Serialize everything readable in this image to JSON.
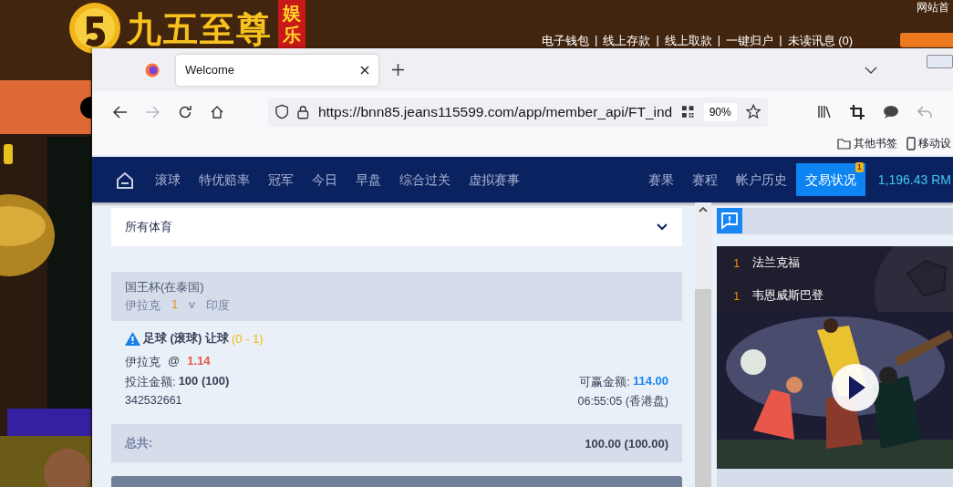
{
  "site_header": {
    "logo_text": "九五至尊",
    "logo_badge": "娱乐",
    "top_link": "网站首",
    "separator": "|",
    "links": [
      "电子钱包",
      "线上存款",
      "线上取款",
      "一键归户",
      "未读讯息 (0)"
    ]
  },
  "browser": {
    "tabs": [
      {
        "label": "Welcome",
        "selected": true
      }
    ],
    "url": "https://bnn85.jeans115599.com/app/member_api/FT_ind",
    "zoom": "90%",
    "forward_disabled": true,
    "bookmarks": [
      "其他书签",
      "移动设"
    ]
  },
  "nav": {
    "left_items": [
      {
        "label": "滚球",
        "selected": false
      },
      {
        "label": "特优赔率",
        "selected": false
      },
      {
        "label": "冠军",
        "selected": false
      },
      {
        "label": "今日",
        "selected": false
      },
      {
        "label": "早盘",
        "selected": false
      },
      {
        "label": "综合过关",
        "selected": false
      },
      {
        "label": "虚拟赛事",
        "selected": false
      }
    ],
    "right_items": [
      {
        "label": "赛果",
        "selected": false
      },
      {
        "label": "赛程",
        "selected": false
      },
      {
        "label": "帐户历史",
        "selected": false
      },
      {
        "label": "交易状况",
        "selected": true,
        "badge": "1"
      }
    ],
    "balance": "1,196.43 RM"
  },
  "sport_filter": {
    "value": "所有体育"
  },
  "match": {
    "league": "国王杯(在泰国)",
    "home": "伊拉克",
    "score": "1",
    "vs": "v",
    "away": "印度"
  },
  "bet": {
    "title": "足球 (滚球) 让球",
    "handicap": "(0 - 1)",
    "pick": "伊拉克",
    "at": "@",
    "odds": "1.14",
    "stake_label": "投注金额:",
    "stake": "100 (100)",
    "win_label": "可赢金额:",
    "win": "114.00",
    "ticket": "342532661",
    "time": "06:55:05 (香港盘)"
  },
  "total": {
    "label": "总共:",
    "value": "100.00 (100.00)"
  },
  "live": {
    "matches": [
      {
        "score": "1",
        "team": "法兰克福"
      },
      {
        "score": "1",
        "team": "韦恩威斯巴登"
      }
    ]
  }
}
